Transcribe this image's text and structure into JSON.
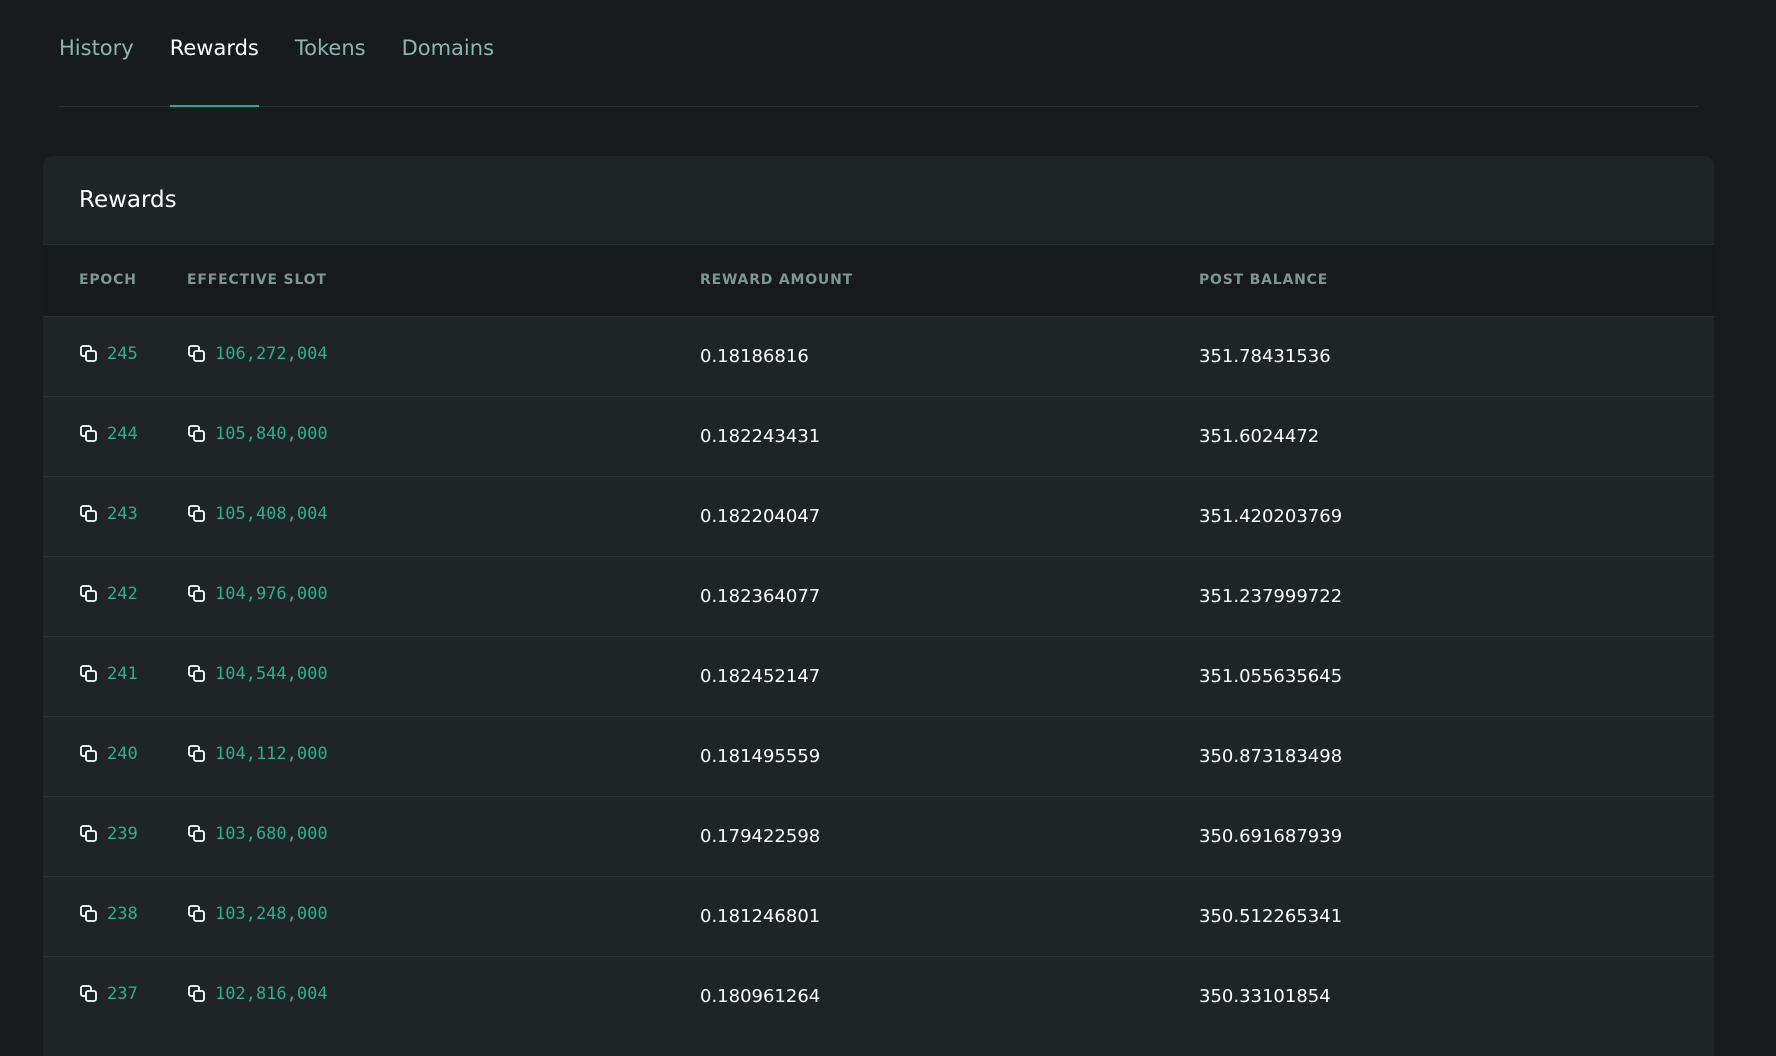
{
  "tabs": [
    {
      "label": "History",
      "active": false
    },
    {
      "label": "Rewards",
      "active": true
    },
    {
      "label": "Tokens",
      "active": false
    },
    {
      "label": "Domains",
      "active": false
    }
  ],
  "card": {
    "title": "Rewards"
  },
  "table": {
    "headers": {
      "epoch": "EPOCH",
      "slot": "EFFECTIVE SLOT",
      "reward": "REWARD AMOUNT",
      "balance": "POST BALANCE"
    },
    "rows": [
      {
        "epoch": "245",
        "slot": "106,272,004",
        "reward": "0.18186816",
        "balance": "351.78431536"
      },
      {
        "epoch": "244",
        "slot": "105,840,000",
        "reward": "0.182243431",
        "balance": "351.6024472"
      },
      {
        "epoch": "243",
        "slot": "105,408,004",
        "reward": "0.182204047",
        "balance": "351.420203769"
      },
      {
        "epoch": "242",
        "slot": "104,976,000",
        "reward": "0.182364077",
        "balance": "351.237999722"
      },
      {
        "epoch": "241",
        "slot": "104,544,000",
        "reward": "0.182452147",
        "balance": "351.055635645"
      },
      {
        "epoch": "240",
        "slot": "104,112,000",
        "reward": "0.181495559",
        "balance": "350.873183498"
      },
      {
        "epoch": "239",
        "slot": "103,680,000",
        "reward": "0.179422598",
        "balance": "350.691687939"
      },
      {
        "epoch": "238",
        "slot": "103,248,000",
        "reward": "0.181246801",
        "balance": "350.512265341"
      },
      {
        "epoch": "237",
        "slot": "102,816,004",
        "reward": "0.180961264",
        "balance": "350.33101854"
      }
    ]
  },
  "colors": {
    "accent": "#1ab394",
    "link": "#27b08e",
    "tab_inactive": "#86b8b0",
    "background": "#171b1b",
    "card": "#1f2526"
  },
  "icons": {
    "copy": "copy-icon"
  }
}
